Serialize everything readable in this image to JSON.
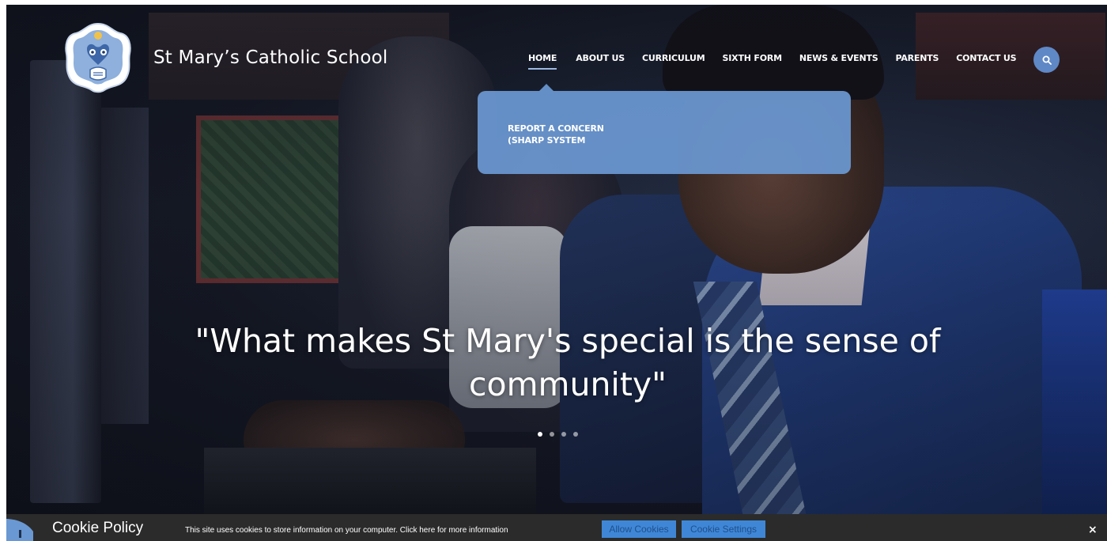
{
  "header": {
    "school_name": "St Mary’s Catholic School",
    "logo_icon": "school-crest-icon"
  },
  "nav": {
    "items": [
      {
        "label": "HOME",
        "active": true
      },
      {
        "label": "ABOUT US"
      },
      {
        "label": "CURRICULUM"
      },
      {
        "label": "SIXTH FORM"
      },
      {
        "label": "NEWS & EVENTS"
      },
      {
        "label": "PARENTS"
      },
      {
        "label": "CONTACT US"
      }
    ],
    "search_icon": "search-icon"
  },
  "dropdown": {
    "item_line1": "REPORT A CONCERN",
    "item_line2": "(SHARP SYSTEM"
  },
  "hero": {
    "quote_line1": "\"What makes St Mary's special is the sense of",
    "quote_line2": "community\"",
    "slide_count": 4,
    "active_slide": 1
  },
  "cookie_bar": {
    "title": "Cookie Policy",
    "text": "This site uses cookies to store information on your computer. Click here for more information",
    "allow_label": "Allow Cookies",
    "settings_label": "Cookie Settings",
    "close_label": "×"
  },
  "colors": {
    "accent_blue": "#5f88c6",
    "dropdown_bg": "#6a98d2",
    "cookie_bar_bg": "#2b2b2b",
    "cookie_button_bg": "#3f87d6"
  }
}
